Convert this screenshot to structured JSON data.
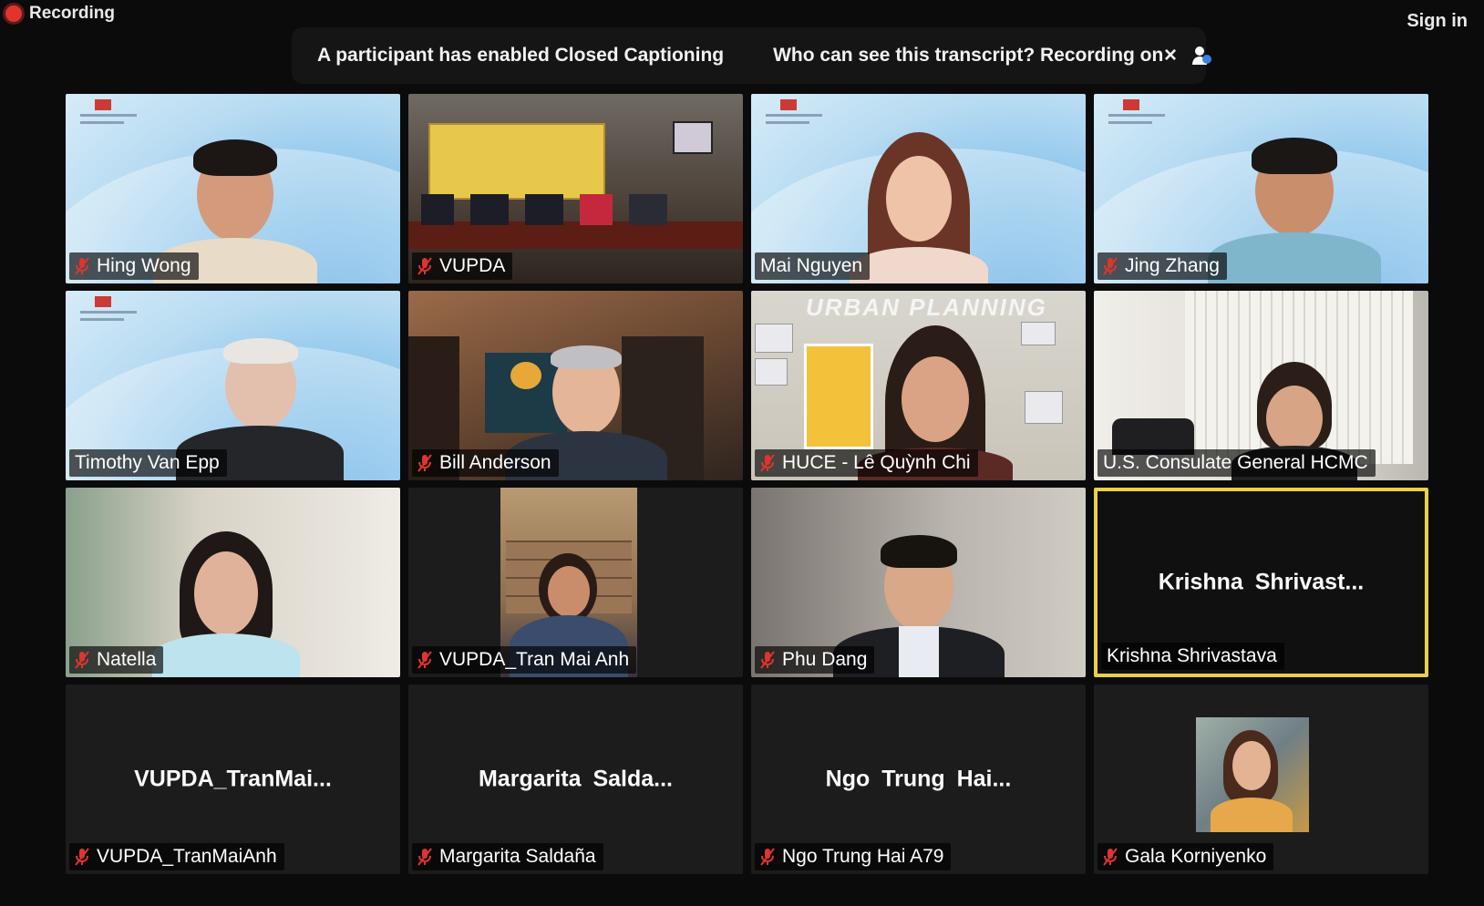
{
  "recording": {
    "label": "Recording"
  },
  "top_right": {
    "sign_in": "Sign in"
  },
  "banner": {
    "message": "A participant has enabled Closed Captioning",
    "question": "Who can see this transcript? Recording on",
    "close": "×"
  },
  "tiles": [
    {
      "name": "Hing Wong",
      "muted": true
    },
    {
      "name": "VUPDA",
      "muted": true
    },
    {
      "name": "Mai Nguyen",
      "muted": false
    },
    {
      "name": "Jing Zhang",
      "muted": true
    },
    {
      "name": "Timothy Van Epp",
      "muted": false
    },
    {
      "name": "Bill Anderson",
      "muted": true
    },
    {
      "name": "HUCE - Lê Quỳnh Chi",
      "muted": true
    },
    {
      "name": "U.S. Consulate General HCMC",
      "muted": false
    },
    {
      "name": "Natella",
      "muted": true
    },
    {
      "name": "VUPDA_Tran Mai Anh",
      "muted": true
    },
    {
      "name": "Phu Dang",
      "muted": true
    },
    {
      "name": "Krishna Shrivastava",
      "muted": false,
      "display": "Krishna  Shrivast...",
      "active_speaker": true
    },
    {
      "name": "VUPDA_TranMaiAnh",
      "muted": true,
      "display": "VUPDA_TranMai..."
    },
    {
      "name": "Margarita Saldaña",
      "muted": true,
      "display": "Margarita  Salda..."
    },
    {
      "name": "Ngo Trung Hai A79",
      "muted": true,
      "display": "Ngo  Trung  Hai..."
    },
    {
      "name": "Gala Korniyenko",
      "muted": true
    }
  ],
  "scene_text": {
    "urban_planning": "URBAN PLANNING"
  },
  "colors": {
    "active_speaker": "#e9d04a",
    "mic_off": "#e0342e",
    "recording_dot": "#e0342e"
  }
}
